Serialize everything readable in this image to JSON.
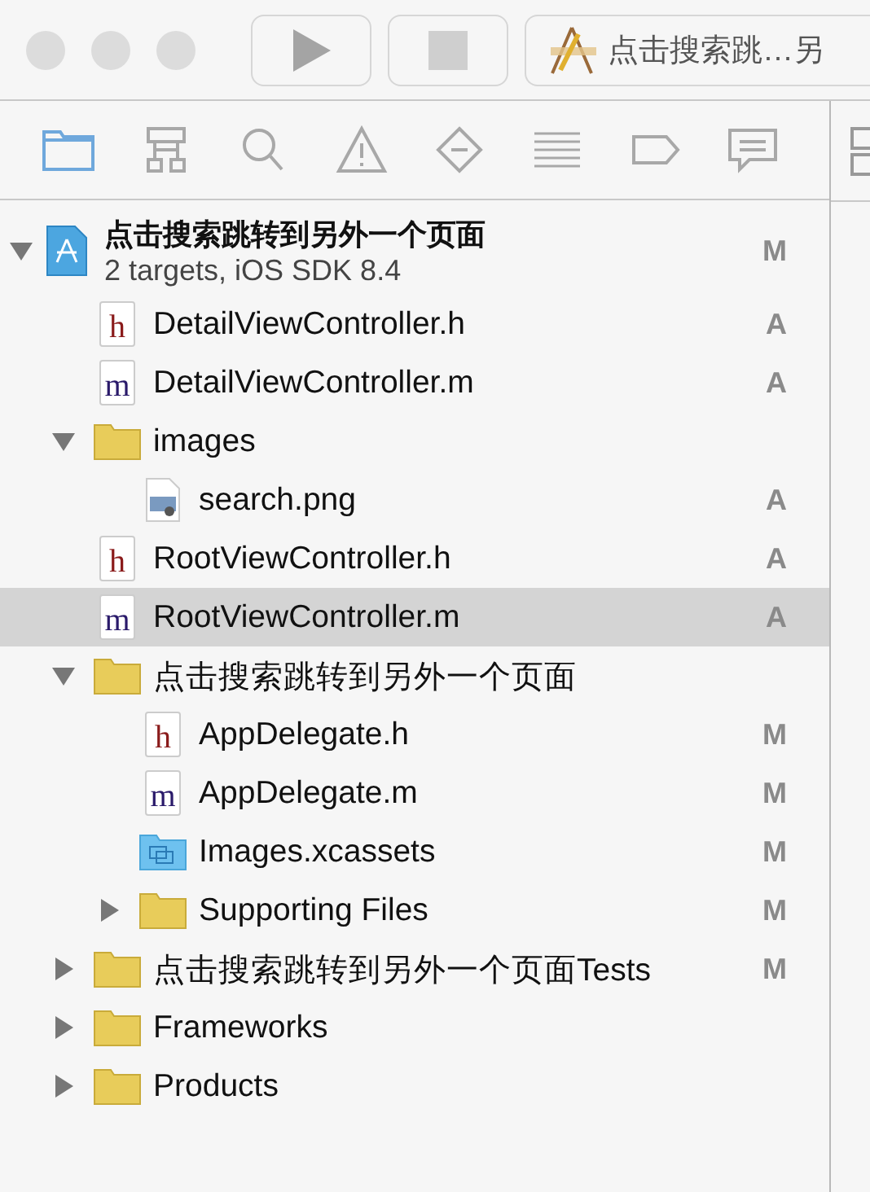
{
  "toolbar": {
    "scheme": "点击搜索跳…另"
  },
  "navigator_tabs": [
    {
      "kind": "folder",
      "selected": true
    },
    {
      "kind": "hierarchy",
      "selected": false
    },
    {
      "kind": "search",
      "selected": false
    },
    {
      "kind": "warning",
      "selected": false
    },
    {
      "kind": "test",
      "selected": false
    },
    {
      "kind": "debug",
      "selected": false
    },
    {
      "kind": "breakpoint",
      "selected": false
    },
    {
      "kind": "report",
      "selected": false
    }
  ],
  "project": {
    "name": "点击搜索跳转到另外一个页面",
    "subtitle": "2 targets, iOS SDK 8.4",
    "status": "M",
    "expanded": true,
    "children": [
      {
        "kind": "header",
        "letter": "h",
        "name": "DetailViewController.h",
        "status": "A",
        "selected": false
      },
      {
        "kind": "source",
        "letter": "m",
        "name": "DetailViewController.m",
        "status": "A",
        "selected": false
      },
      {
        "kind": "folder",
        "name": "images",
        "expanded": true,
        "selected": false,
        "children": [
          {
            "kind": "image",
            "name": "search.png",
            "status": "A",
            "selected": false
          }
        ]
      },
      {
        "kind": "header",
        "letter": "h",
        "name": "RootViewController.h",
        "status": "A",
        "selected": false
      },
      {
        "kind": "source",
        "letter": "m",
        "name": "RootViewController.m",
        "status": "A",
        "selected": true
      },
      {
        "kind": "folder",
        "name": "点击搜索跳转到另外一个页面",
        "expanded": true,
        "selected": false,
        "children": [
          {
            "kind": "header",
            "letter": "h",
            "name": "AppDelegate.h",
            "status": "M",
            "selected": false
          },
          {
            "kind": "source",
            "letter": "m",
            "name": "AppDelegate.m",
            "status": "M",
            "selected": false
          },
          {
            "kind": "assets",
            "name": "Images.xcassets",
            "status": "M",
            "selected": false
          },
          {
            "kind": "folder",
            "name": "Supporting Files",
            "status": "M",
            "expanded": false,
            "selected": false
          }
        ]
      },
      {
        "kind": "folder",
        "name": "点击搜索跳转到另外一个页面Tests",
        "status": "M",
        "expanded": false,
        "selected": false
      },
      {
        "kind": "folder",
        "name": "Frameworks",
        "expanded": false,
        "selected": false
      },
      {
        "kind": "folder",
        "name": "Products",
        "expanded": false,
        "selected": false
      }
    ]
  }
}
